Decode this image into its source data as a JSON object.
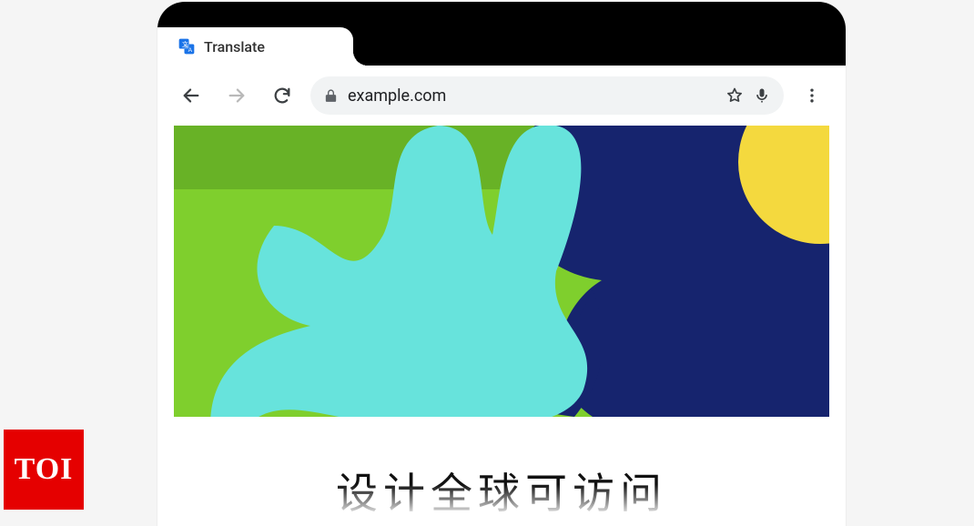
{
  "tab": {
    "label": "Translate",
    "icon": "translate-icon"
  },
  "toolbar": {
    "back_icon": "arrow-left-icon",
    "forward_icon": "arrow-right-icon",
    "reload_icon": "reload-icon",
    "lock_icon": "lock-icon",
    "url": "example.com",
    "star_icon": "star-outline-icon",
    "mic_icon": "mic-icon",
    "menu_icon": "more-vert-icon"
  },
  "page": {
    "hero_colors": {
      "bg": "#7fcf2d",
      "blob_cyan": "#4fd7d5",
      "blob_navy": "#16246e",
      "blob_yellow": "#f4d93e",
      "bg_dark": "#3f7a1a"
    },
    "cjk_text": "设计全球可访问"
  },
  "badge": {
    "text": "TOI"
  }
}
